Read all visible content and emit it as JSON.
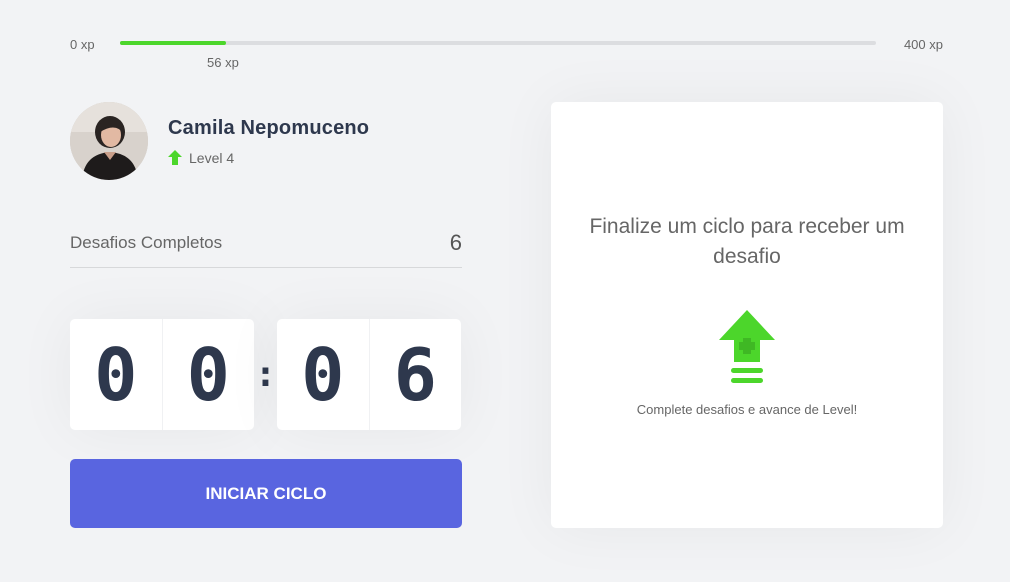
{
  "xp": {
    "min_label": "0 xp",
    "max_label": "400 xp",
    "current_label": "56 xp",
    "current": 56,
    "max": 400
  },
  "profile": {
    "name": "Camila Nepomuceno",
    "level_label": "Level 4",
    "avatar_icon": "user-photo",
    "level_icon": "level-up-arrow-icon"
  },
  "completed": {
    "label": "Desafios Completos",
    "value": "6"
  },
  "countdown": {
    "minute_left": "0",
    "minute_right": "0",
    "separator": ":",
    "second_left": "0",
    "second_right": "6"
  },
  "start_button": {
    "label": "INICIAR CICLO"
  },
  "challenge": {
    "title": "Finalize um ciclo para receber um desafio",
    "hint": "Complete desafios e avance de Level!",
    "icon": "level-up-icon"
  },
  "colors": {
    "accent_green": "#4cd62b",
    "button_blue": "#5965e0",
    "title_dark": "#2e384d",
    "text_gray": "#666666",
    "background": "#f2f3f5"
  }
}
